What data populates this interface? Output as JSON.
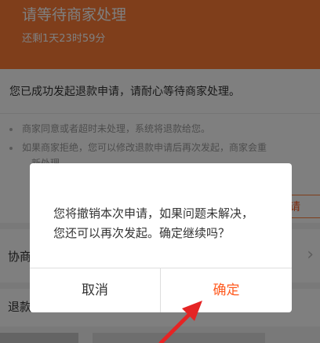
{
  "header": {
    "title": "请等待商家处理",
    "countdown": "还剩1天23时59分"
  },
  "card": {
    "main_text": "您已成功发起退款申请，请耐心等待商家处理。",
    "bullets": [
      {
        "line1": "商家同意或者超时未处理，系统将退款给您。"
      },
      {
        "line1": "如果商家拒绝，您可以修改退款申请后再次发起，商家会重",
        "line2": "新处理。"
      }
    ],
    "apply_button_partial": "请"
  },
  "rows": {
    "negotiate_label_partial": "协商",
    "refund_label_partial": "退款"
  },
  "dialog": {
    "line1": "您将撤销本次申请，如果问题未解决，",
    "line2": "您还可以再次发起。确定继续吗？",
    "cancel_label": "取消",
    "confirm_label": "确定"
  },
  "colors": {
    "brand": "#ff7c37",
    "confirm": "#ff5a1f",
    "arrow": "#e52424"
  }
}
